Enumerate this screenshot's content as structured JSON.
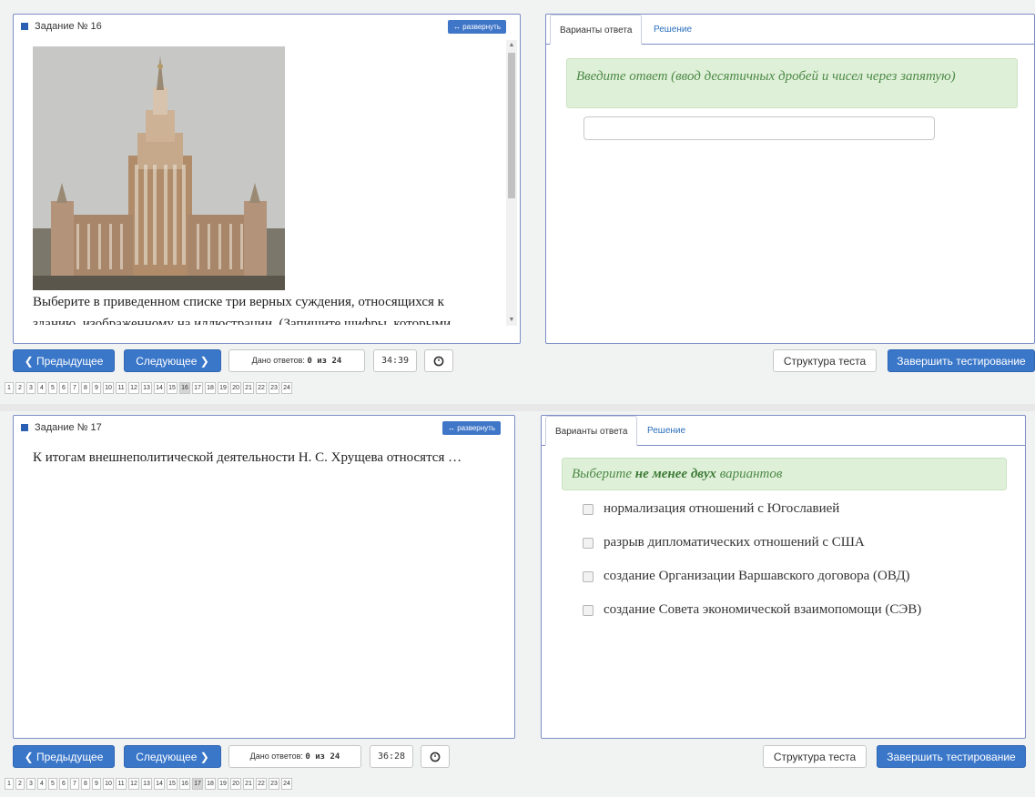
{
  "blocks": [
    {
      "task_label": "Задание № 16",
      "expand_label": "↔ развернуть",
      "question_text_1": "Выберите в приведенном списке три верных суждения, относящихся к",
      "question_text_2": "зданию, изображенному на иллюстрации. (Запишите шифры, которыми",
      "tabs": [
        "Варианты ответа",
        "Решение"
      ],
      "hint": "Введите ответ (ввод десятичных дробей и чисел через запятую)",
      "answer_value": "",
      "prev_label": "❮ Предыдущее",
      "next_label": "Следующее ❯",
      "answered_label": "Дано ответов:",
      "answered_value": "0 из 24",
      "timer": "34:39",
      "structure_label": "Структура теста",
      "finish_label": "Завершить тестирование",
      "current_page": "16"
    },
    {
      "task_label": "Задание № 17",
      "expand_label": "↔ развернуть",
      "question_text_1": "К итогам внешнеполитической деятельности Н. С. Хрущева относятся …",
      "tabs": [
        "Варианты ответа",
        "Решение"
      ],
      "hint_prefix": "Выберите",
      "hint_bold": "не менее двух",
      "hint_suffix": "вариантов",
      "options": [
        "нормализация отношений с Югославией",
        "разрыв дипломатических отношений с США",
        "создание Организации Варшавского договора (ОВД)",
        "создание Совета экономической взаимопомощи (СЭВ)"
      ],
      "prev_label": "❮ Предыдущее",
      "next_label": "Следующее ❯",
      "answered_label": "Дано ответов:",
      "answered_value": "0 из 24",
      "timer": "36:28",
      "structure_label": "Структура теста",
      "finish_label": "Завершить тестирование",
      "current_page": "17"
    }
  ],
  "pages": [
    "1",
    "2",
    "3",
    "4",
    "5",
    "6",
    "7",
    "8",
    "9",
    "10",
    "11",
    "12",
    "13",
    "14",
    "15",
    "16",
    "17",
    "18",
    "19",
    "20",
    "21",
    "22",
    "23",
    "24"
  ],
  "icons": {
    "clock": "clock-icon",
    "building_photo": "Moscow State University main building photo"
  }
}
